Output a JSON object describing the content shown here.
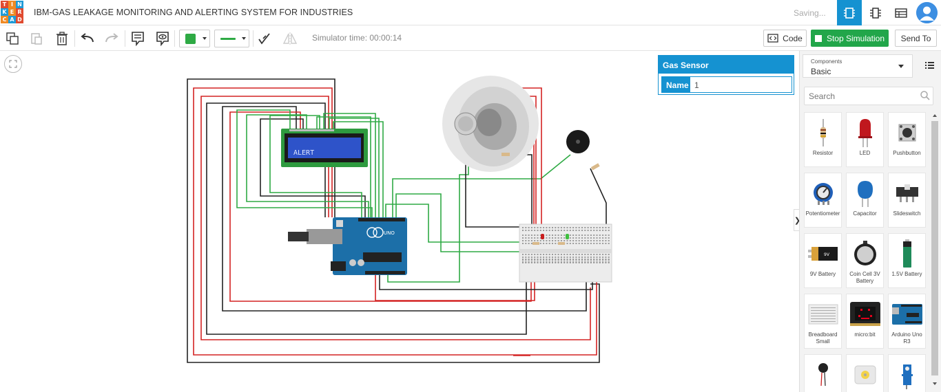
{
  "app": {
    "logo_letters": [
      "T",
      "I",
      "N",
      "K",
      "E",
      "R",
      "C",
      "A",
      "D"
    ],
    "logo_colors": [
      "#e04a2f",
      "#f08a24",
      "#1f9bd7",
      "#1f9bd7",
      "#f08a24",
      "#e04a2f",
      "#f08a24",
      "#1f9bd7",
      "#e04a2f"
    ],
    "title": "IBM-GAS LEAKAGE MONITORING AND ALERTING SYSTEM FOR INDUSTRIES",
    "status": "Saving..."
  },
  "toolbar": {
    "sim_time": "Simulator time: 00:00:14",
    "code_label": "Code",
    "stop_label": "Stop Simulation",
    "send_label": "Send To",
    "wire_color": "#2eaa44"
  },
  "inspector": {
    "title": "Gas Sensor",
    "name_label": "Name",
    "name_value": "1"
  },
  "lcd": {
    "text": "ALERT"
  },
  "arduino": {
    "label": "UNO"
  },
  "panel": {
    "dropdown_small": "Components",
    "dropdown_value": "Basic",
    "search_placeholder": "Search",
    "components": [
      {
        "label": "Resistor",
        "icon": "resistor-icon"
      },
      {
        "label": "LED",
        "icon": "led-icon"
      },
      {
        "label": "Pushbutton",
        "icon": "pushbutton-icon"
      },
      {
        "label": "Potentiometer",
        "icon": "potentiometer-icon"
      },
      {
        "label": "Capacitor",
        "icon": "capacitor-icon"
      },
      {
        "label": "Slideswitch",
        "icon": "slideswitch-icon"
      },
      {
        "label": "9V Battery",
        "icon": "battery-9v-icon"
      },
      {
        "label": "Coin Cell 3V Battery",
        "icon": "coin-cell-icon"
      },
      {
        "label": "1.5V Battery",
        "icon": "battery-1-5v-icon"
      },
      {
        "label": "Breadboard Small",
        "icon": "breadboard-icon"
      },
      {
        "label": "micro:bit",
        "icon": "microbit-icon"
      },
      {
        "label": "Arduino Uno R3",
        "icon": "arduino-icon"
      },
      {
        "label": "",
        "icon": "vibration-motor-icon"
      },
      {
        "label": "",
        "icon": "dc-motor-icon"
      },
      {
        "label": "",
        "icon": "micro-servo-icon"
      }
    ]
  }
}
